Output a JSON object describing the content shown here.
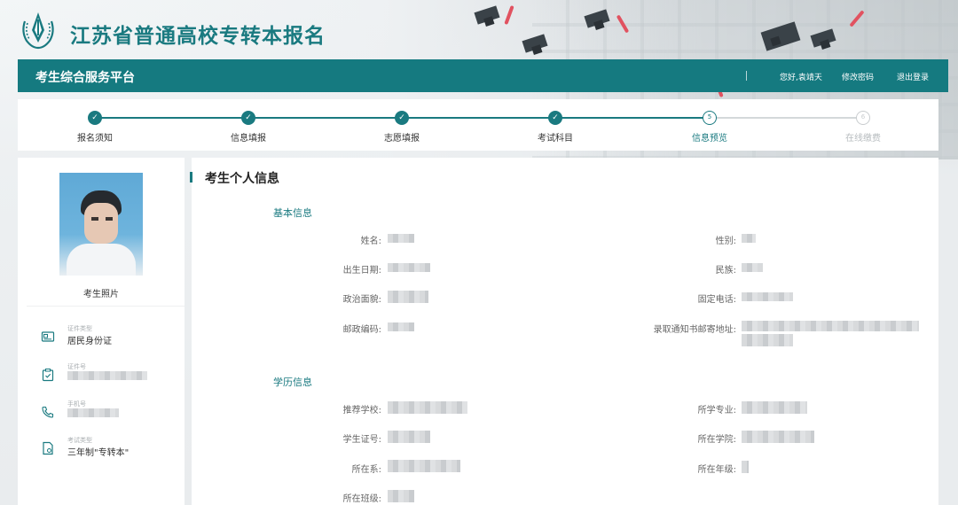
{
  "header": {
    "site_title": "江苏省普通高校专转本报名"
  },
  "navbar": {
    "brand": "考生综合服务平台",
    "greeting": "您好,袁靖天",
    "change_password": "修改密码",
    "logout": "退出登录"
  },
  "steps": [
    {
      "label": "报名须知",
      "status": "done",
      "symbol": "✓"
    },
    {
      "label": "信息填报",
      "status": "done",
      "symbol": "✓"
    },
    {
      "label": "志愿填报",
      "status": "done",
      "symbol": "✓"
    },
    {
      "label": "考试科目",
      "status": "done",
      "symbol": "✓"
    },
    {
      "label": "信息预览",
      "status": "current",
      "symbol": "5"
    },
    {
      "label": "在线缴费",
      "status": "pending",
      "symbol": "6"
    }
  ],
  "sidebar": {
    "photo_label": "考生照片",
    "items": [
      {
        "icon": "id-card-icon",
        "caption": "证件类型",
        "value": "居民身份证"
      },
      {
        "icon": "clipboard-icon",
        "caption": "证件号",
        "value": ""
      },
      {
        "icon": "phone-icon",
        "caption": "手机号",
        "value": ""
      },
      {
        "icon": "exam-type-icon",
        "caption": "考试类型",
        "value": "三年制\"专转本\""
      }
    ]
  },
  "main": {
    "title": "考生个人信息",
    "basic": {
      "title": "基本信息",
      "fields": {
        "name": "姓名:",
        "gender": "性别:",
        "birth": "出生日期:",
        "ethnicity": "民族:",
        "political": "政治面貌:",
        "phone": "固定电话:",
        "postcode": "邮政编码:",
        "address": "录取通知书邮寄地址:"
      }
    },
    "education": {
      "title": "学历信息",
      "fields": {
        "school": "推荐学校:",
        "major": "所学专业:",
        "student_id": "学生证号:",
        "college": "所在学院:",
        "department": "所在系:",
        "grade": "所在年级:",
        "class": "所在班级:"
      }
    }
  },
  "colors": {
    "accent": "#157a80",
    "text": "#333333",
    "muted": "#a9aeb1"
  }
}
